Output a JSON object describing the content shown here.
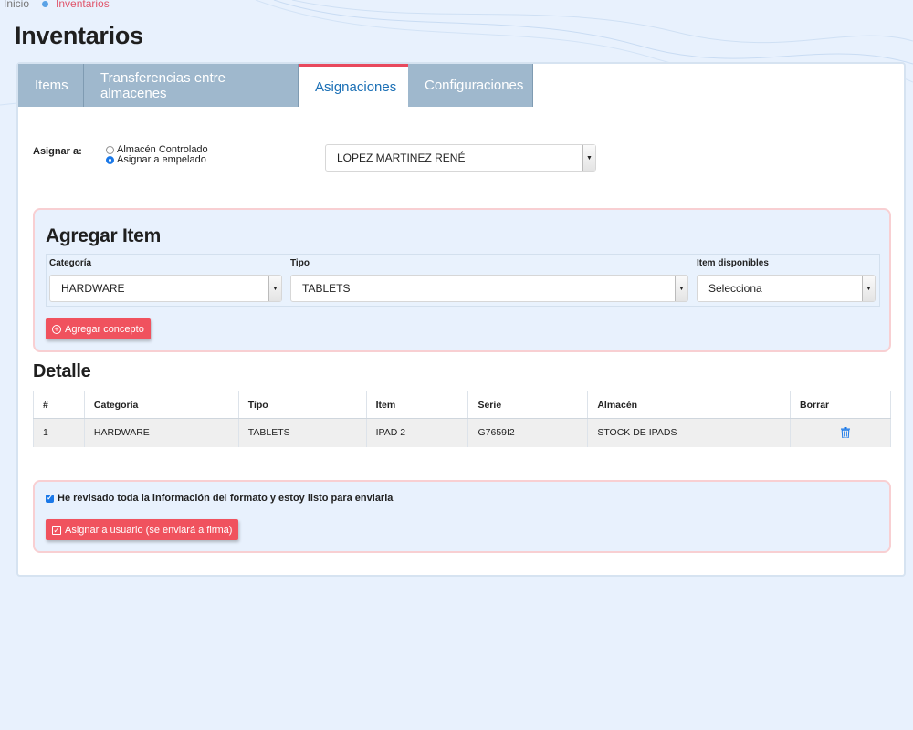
{
  "breadcrumb": {
    "home": "Inicio",
    "current": "Inventarios"
  },
  "page_title": "Inventarios",
  "tabs": [
    {
      "label": "Items",
      "active": false
    },
    {
      "label": "Transferencias entre almacenes",
      "active": false
    },
    {
      "label": "Asignaciones",
      "active": true
    },
    {
      "label": "Configuraciones",
      "active": false
    }
  ],
  "assign": {
    "label": "Asignar a:",
    "options": [
      {
        "label": "Almacén Controlado",
        "checked": false
      },
      {
        "label": "Asignar a empelado",
        "checked": true
      }
    ],
    "employee_select": "LOPEZ MARTINEZ RENÉ"
  },
  "add_item": {
    "title": "Agregar Item",
    "category_label": "Categoría",
    "category_value": "HARDWARE",
    "type_label": "Tipo",
    "type_value": "TABLETS",
    "available_label": "Item disponibles",
    "available_value": "Selecciona",
    "add_button": "Agregar concepto"
  },
  "detail": {
    "title": "Detalle",
    "columns": [
      "#",
      "Categoría",
      "Tipo",
      "Item",
      "Serie",
      "Almacén",
      "Borrar"
    ],
    "rows": [
      [
        "1",
        "HARDWARE",
        "TABLETS",
        "IPAD 2",
        "G7659I2",
        "STOCK DE IPADS"
      ]
    ]
  },
  "confirm": {
    "checkbox_label": "He revisado toda la información del formato y estoy listo para enviarla",
    "checked": true,
    "submit_button": "Asignar a usuario (se enviará a firma)"
  },
  "colors": {
    "accent_red": "#f0525e",
    "tab_inactive": "#9fb8cd",
    "tab_active_text": "#1a6fb5",
    "link_blue": "#1a78e8"
  },
  "icons": {
    "add": "plus-circle-icon",
    "trash": "trash-icon",
    "submit": "check-square-icon",
    "caret": "caret-down-icon"
  }
}
